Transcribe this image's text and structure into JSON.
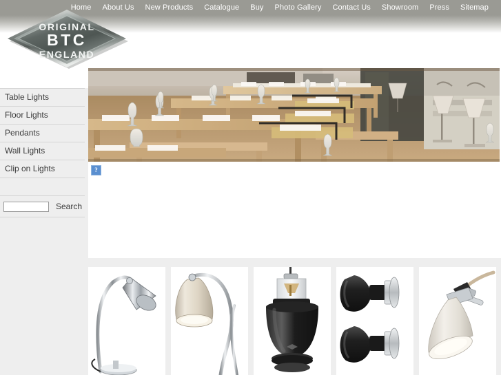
{
  "site": {
    "logo": {
      "line1": "ORIGINAL",
      "line2": "BTC",
      "line3": "ENGLAND",
      "alt": "Original BTC England"
    }
  },
  "topnav": {
    "items": [
      {
        "label": "Home"
      },
      {
        "label": "About Us"
      },
      {
        "label": "New Products"
      },
      {
        "label": "Catalogue"
      },
      {
        "label": "Buy"
      },
      {
        "label": "Photo Gallery"
      },
      {
        "label": "Contact Us"
      },
      {
        "label": "Showroom"
      },
      {
        "label": "Press"
      },
      {
        "label": "Sitemap"
      }
    ]
  },
  "sidebar": {
    "items": [
      {
        "label": "Table Lights"
      },
      {
        "label": "Floor Lights"
      },
      {
        "label": "Pendants"
      },
      {
        "label": "Wall Lights"
      },
      {
        "label": "Clip on Lights"
      }
    ],
    "search": {
      "value": "",
      "placeholder": "",
      "button_label": "Search"
    }
  },
  "main": {
    "banner": {
      "alt": "Restaurant interior with wooden tables, benches and table lamps"
    },
    "broken_image": {
      "glyph": "?",
      "alt": "missing image placeholder"
    }
  },
  "thumbnails": [
    {
      "alt": "Chrome task table lamp",
      "name": "chrome-table-lamp"
    },
    {
      "alt": "Cream ceramic table lamp",
      "name": "cream-table-lamp"
    },
    {
      "alt": "Black industrial pendant light",
      "name": "black-pendant-light"
    },
    {
      "alt": "Pair of black wall lights",
      "name": "black-wall-lights"
    },
    {
      "alt": "White clip on light",
      "name": "white-clip-on-light"
    }
  ],
  "colors": {
    "header_bar": "#9a9a94",
    "nav_text": "#ffffff",
    "sidebar_text": "#3a3a3a",
    "rule": "#d5d5d5",
    "page_bg": "#eeeeee",
    "content_bg": "#ffffff",
    "placeholder_blue": "#5a8fd0"
  }
}
